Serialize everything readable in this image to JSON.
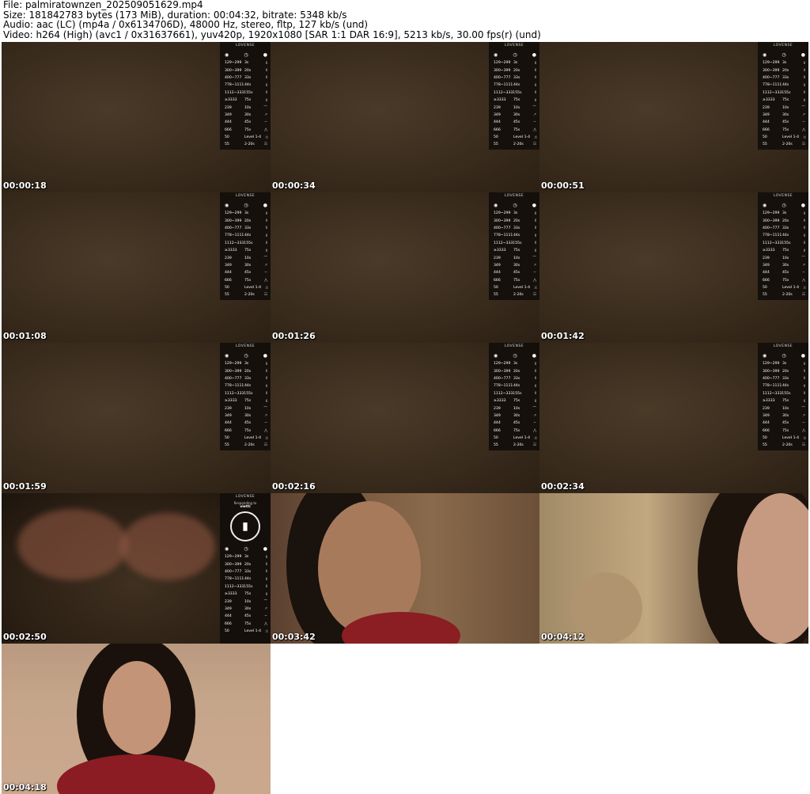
{
  "header": {
    "file": "File: palmiratownzen_202509051629.mp4",
    "size": "Size: 181842783 bytes (173 MiB), duration: 00:04:32, bitrate: 5348 kb/s",
    "audio": "Audio: aac (LC) (mp4a / 0x6134706D), 48000 Hz, stereo, fltp, 127 kb/s (und)",
    "video": "Video: h264 (High) (avc1 / 0x31637661), yuv420p, 1920x1080 [SAR 1:1 DAR 16:9], 5213 kb/s, 30.00 fps(r) (und)"
  },
  "panel": {
    "brand": "LOVENSE",
    "responding": "Responding to",
    "user": "vietti",
    "rows": [
      {
        "tokens": "129~299",
        "time": "3s"
      },
      {
        "tokens": "300~399",
        "time": "20s"
      },
      {
        "tokens": "400~777",
        "time": "33s"
      },
      {
        "tokens": "778~1111",
        "time": "44s"
      },
      {
        "tokens": "1112~333155s",
        "time": ""
      },
      {
        "tokens": "≥3333",
        "time": "75s"
      },
      {
        "tokens": "239",
        "time": "10s"
      },
      {
        "tokens": "349",
        "time": "30s"
      },
      {
        "tokens": "444",
        "time": "45s"
      },
      {
        "tokens": "666",
        "time": "75s"
      },
      {
        "tokens": "50",
        "time": "Level 1-4"
      },
      {
        "tokens": "55",
        "time": "2-20s"
      }
    ]
  },
  "timestamps": [
    "00:00:18",
    "00:00:34",
    "00:00:51",
    "00:01:08",
    "00:01:26",
    "00:01:42",
    "00:01:59",
    "00:02:16",
    "00:02:34",
    "00:02:50",
    "00:03:42",
    "00:04:12",
    "00:04:18"
  ]
}
